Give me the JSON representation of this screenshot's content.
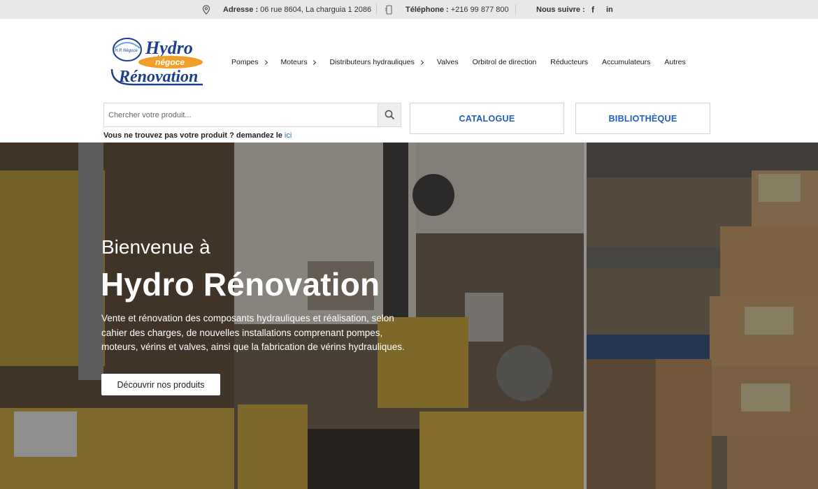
{
  "topbar": {
    "address_label": "Adresse :",
    "address_value": "06 rue 8604, La charguia 1 2086",
    "phone_label": "Téléphone :",
    "phone_value": "+216 99 877 800",
    "follow_label": "Nous suivre :",
    "facebook": "f",
    "linkedin": "in"
  },
  "logo": {
    "line1": "Hydro",
    "badge": "négoce",
    "line2": "Rénovation",
    "small": "H.R Négoce"
  },
  "nav": {
    "items": [
      {
        "label": "Pompes",
        "has_submenu": true
      },
      {
        "label": "Moteurs",
        "has_submenu": true
      },
      {
        "label": "Distributeurs hydrauliques",
        "has_submenu": true
      },
      {
        "label": "Valves",
        "has_submenu": false
      },
      {
        "label": "Orbitrol de direction",
        "has_submenu": false
      },
      {
        "label": "Réducteurs",
        "has_submenu": false
      },
      {
        "label": "Accumulateurs",
        "has_submenu": false
      },
      {
        "label": "Autres",
        "has_submenu": false
      }
    ]
  },
  "search": {
    "placeholder": "Chercher votre produit...",
    "value": ""
  },
  "buttons": {
    "catalogue": "CATALOGUE",
    "bibliotheque": "BIBLIOTHÈQUE"
  },
  "help": {
    "text": "Vous ne trouvez pas votre produit ? demandez le",
    "link": "ici"
  },
  "hero": {
    "subtitle": "Bienvenue à",
    "title": "Hydro Rénovation",
    "description": "Vente et rénovation des composants hydrauliques et réalisation, selon cahier des charges, de nouvelles installations comprenant pompes, moteurs, vérins et valves, ainsi que la fabrication de vérins hydrauliques.",
    "cta": "Découvrir nos produits"
  },
  "colors": {
    "accent": "#1f5fbf",
    "topbar_bg": "#e8e8e8",
    "link": "#1f6fd6"
  }
}
